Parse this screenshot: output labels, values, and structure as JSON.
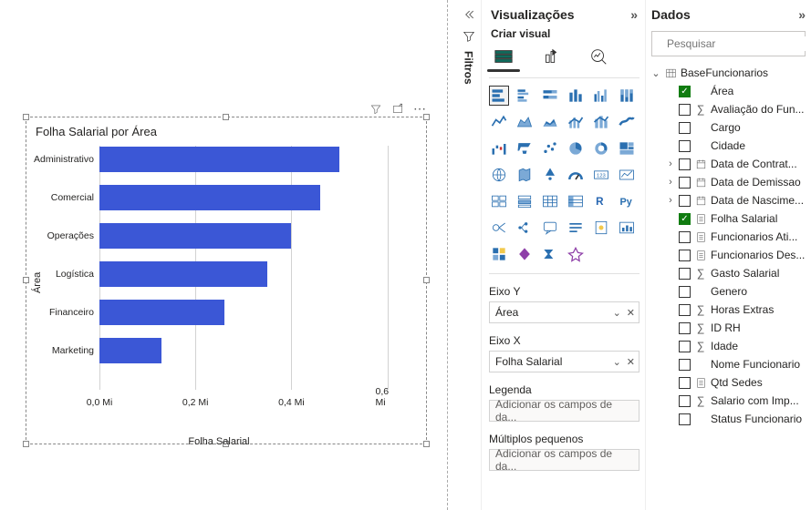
{
  "panels": {
    "filters": "Filtros",
    "visualizations": "Visualizações",
    "criar_visual": "Criar visual",
    "data": "Dados"
  },
  "chart_tile": {
    "title": "Folha Salarial por Área",
    "xlabel": "Folha Salarial",
    "ylabel": "Área"
  },
  "chart_data": {
    "type": "bar",
    "orientation": "horizontal",
    "title": "Folha Salarial por Área",
    "xlabel": "Folha Salarial",
    "ylabel": "Área",
    "x_unit": "Mi",
    "x_ticks": [
      0.0,
      0.2,
      0.4,
      0.6
    ],
    "x_tick_labels": [
      "0,0 Mi",
      "0,2 Mi",
      "0,4 Mi",
      "0,6 Mi"
    ],
    "xlim": [
      0,
      0.65
    ],
    "categories": [
      "Administrativo",
      "Comercial",
      "Operações",
      "Logística",
      "Financeiro",
      "Marketing"
    ],
    "values": [
      0.5,
      0.46,
      0.4,
      0.35,
      0.26,
      0.13
    ]
  },
  "wells": {
    "eixo_y": {
      "label": "Eixo Y",
      "value": "Área"
    },
    "eixo_x": {
      "label": "Eixo X",
      "value": "Folha Salarial"
    },
    "legenda": {
      "label": "Legenda",
      "placeholder": "Adicionar os campos de da..."
    },
    "multiplos": {
      "label": "Múltiplos pequenos",
      "placeholder": "Adicionar os campos de da..."
    }
  },
  "search": {
    "placeholder": "Pesquisar"
  },
  "tree": {
    "table": "BaseFuncionarios",
    "fields": [
      {
        "name": "Área",
        "checked": true,
        "icon": "none"
      },
      {
        "name": "Avaliação do Fun...",
        "checked": false,
        "icon": "sigma"
      },
      {
        "name": "Cargo",
        "checked": false,
        "icon": "none"
      },
      {
        "name": "Cidade",
        "checked": false,
        "icon": "none"
      },
      {
        "name": "Data de Contrat...",
        "checked": false,
        "icon": "date",
        "expandable": true
      },
      {
        "name": "Data de Demissao",
        "checked": false,
        "icon": "date",
        "expandable": true
      },
      {
        "name": "Data de Nascime...",
        "checked": false,
        "icon": "date",
        "expandable": true
      },
      {
        "name": "Folha Salarial",
        "checked": true,
        "icon": "calc"
      },
      {
        "name": "Funcionarios Ati...",
        "checked": false,
        "icon": "calc"
      },
      {
        "name": "Funcionarios Des...",
        "checked": false,
        "icon": "calc"
      },
      {
        "name": "Gasto Salarial",
        "checked": false,
        "icon": "sigma"
      },
      {
        "name": "Genero",
        "checked": false,
        "icon": "none"
      },
      {
        "name": "Horas Extras",
        "checked": false,
        "icon": "sigma"
      },
      {
        "name": "ID RH",
        "checked": false,
        "icon": "sigma"
      },
      {
        "name": "Idade",
        "checked": false,
        "icon": "sigma"
      },
      {
        "name": "Nome Funcionario",
        "checked": false,
        "icon": "none"
      },
      {
        "name": "Qtd Sedes",
        "checked": false,
        "icon": "calc"
      },
      {
        "name": "Salario com Imp...",
        "checked": false,
        "icon": "sigma"
      },
      {
        "name": "Status Funcionario",
        "checked": false,
        "icon": "none"
      }
    ]
  },
  "viz_gallery": {
    "selected_index": 0,
    "icons": [
      "stacked-bar",
      "clustered-bar",
      "stacked-100-bar",
      "stacked-column",
      "clustered-column",
      "stacked-100-column",
      "line",
      "area",
      "stacked-area",
      "line-clustered",
      "line-stacked",
      "ribbon",
      "waterfall",
      "funnel",
      "scatter",
      "pie",
      "donut",
      "treemap",
      "map",
      "filled-map",
      "azure-map",
      "gauge",
      "card",
      "kpi",
      "multi-card",
      "slicer",
      "table",
      "matrix",
      "r-visual",
      "py-visual",
      "key-influencers",
      "decomposition",
      "qa",
      "narrative",
      "paginated",
      "metrics",
      "app",
      "powerapps",
      "powerautomate",
      "custom-visual"
    ]
  }
}
